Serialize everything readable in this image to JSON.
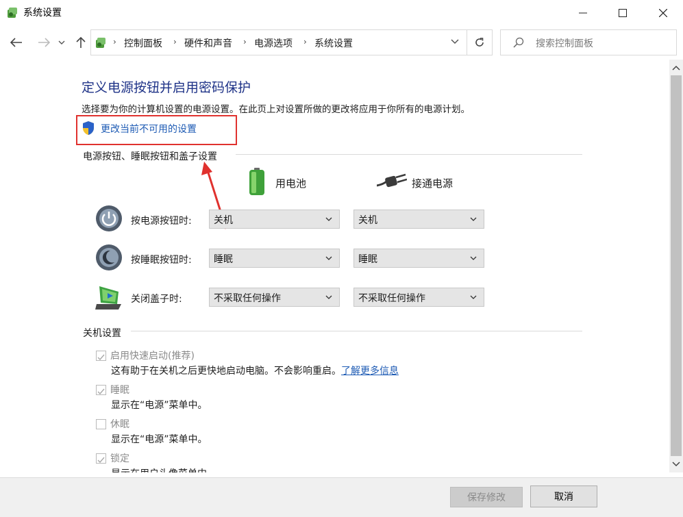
{
  "window": {
    "title": "系统设置",
    "minimize_icon": "minimize-icon",
    "maximize_icon": "maximize-icon",
    "close_icon": "close-icon"
  },
  "address_bar": {
    "breadcrumbs": [
      "控制面板",
      "硬件和声音",
      "电源选项",
      "系统设置"
    ],
    "search_placeholder": "搜索控制面板"
  },
  "page": {
    "title": "定义电源按钮并启用密码保护",
    "description": "选择要为你的计算机设置的电源设置。在此页上对设置所做的更改将应用于你所有的电源计划。",
    "change_settings_link": "更改当前不可用的设置"
  },
  "power_buttons_section": {
    "heading": "电源按钮、睡眠按钮和盖子设置",
    "columns": [
      "用电池",
      "接通电源"
    ],
    "rows": [
      {
        "label": "按电源按钮时:",
        "battery": "关机",
        "plugged": "关机"
      },
      {
        "label": "按睡眠按钮时:",
        "battery": "睡眠",
        "plugged": "睡眠"
      },
      {
        "label": "关闭盖子时:",
        "battery": "不采取任何操作",
        "plugged": "不采取任何操作"
      }
    ]
  },
  "shutdown_section": {
    "heading": "关机设置",
    "items": [
      {
        "label": "启用快速启动(推荐)",
        "checked": true,
        "desc": "这有助于在关机之后更快地启动电脑。不会影响重启。",
        "link": "了解更多信息"
      },
      {
        "label": "睡眠",
        "checked": true,
        "desc": "显示在“电源”菜单中。"
      },
      {
        "label": "休眠",
        "checked": false,
        "desc": "显示在“电源”菜单中。"
      },
      {
        "label": "锁定",
        "checked": true,
        "desc": "显示在用户头像菜单中。"
      }
    ]
  },
  "footer": {
    "save_label": "保存修改",
    "cancel_label": "取消"
  },
  "colors": {
    "title_blue": "#1e3287",
    "link_blue": "#1e5bb4",
    "highlight_red": "#e0312e"
  }
}
